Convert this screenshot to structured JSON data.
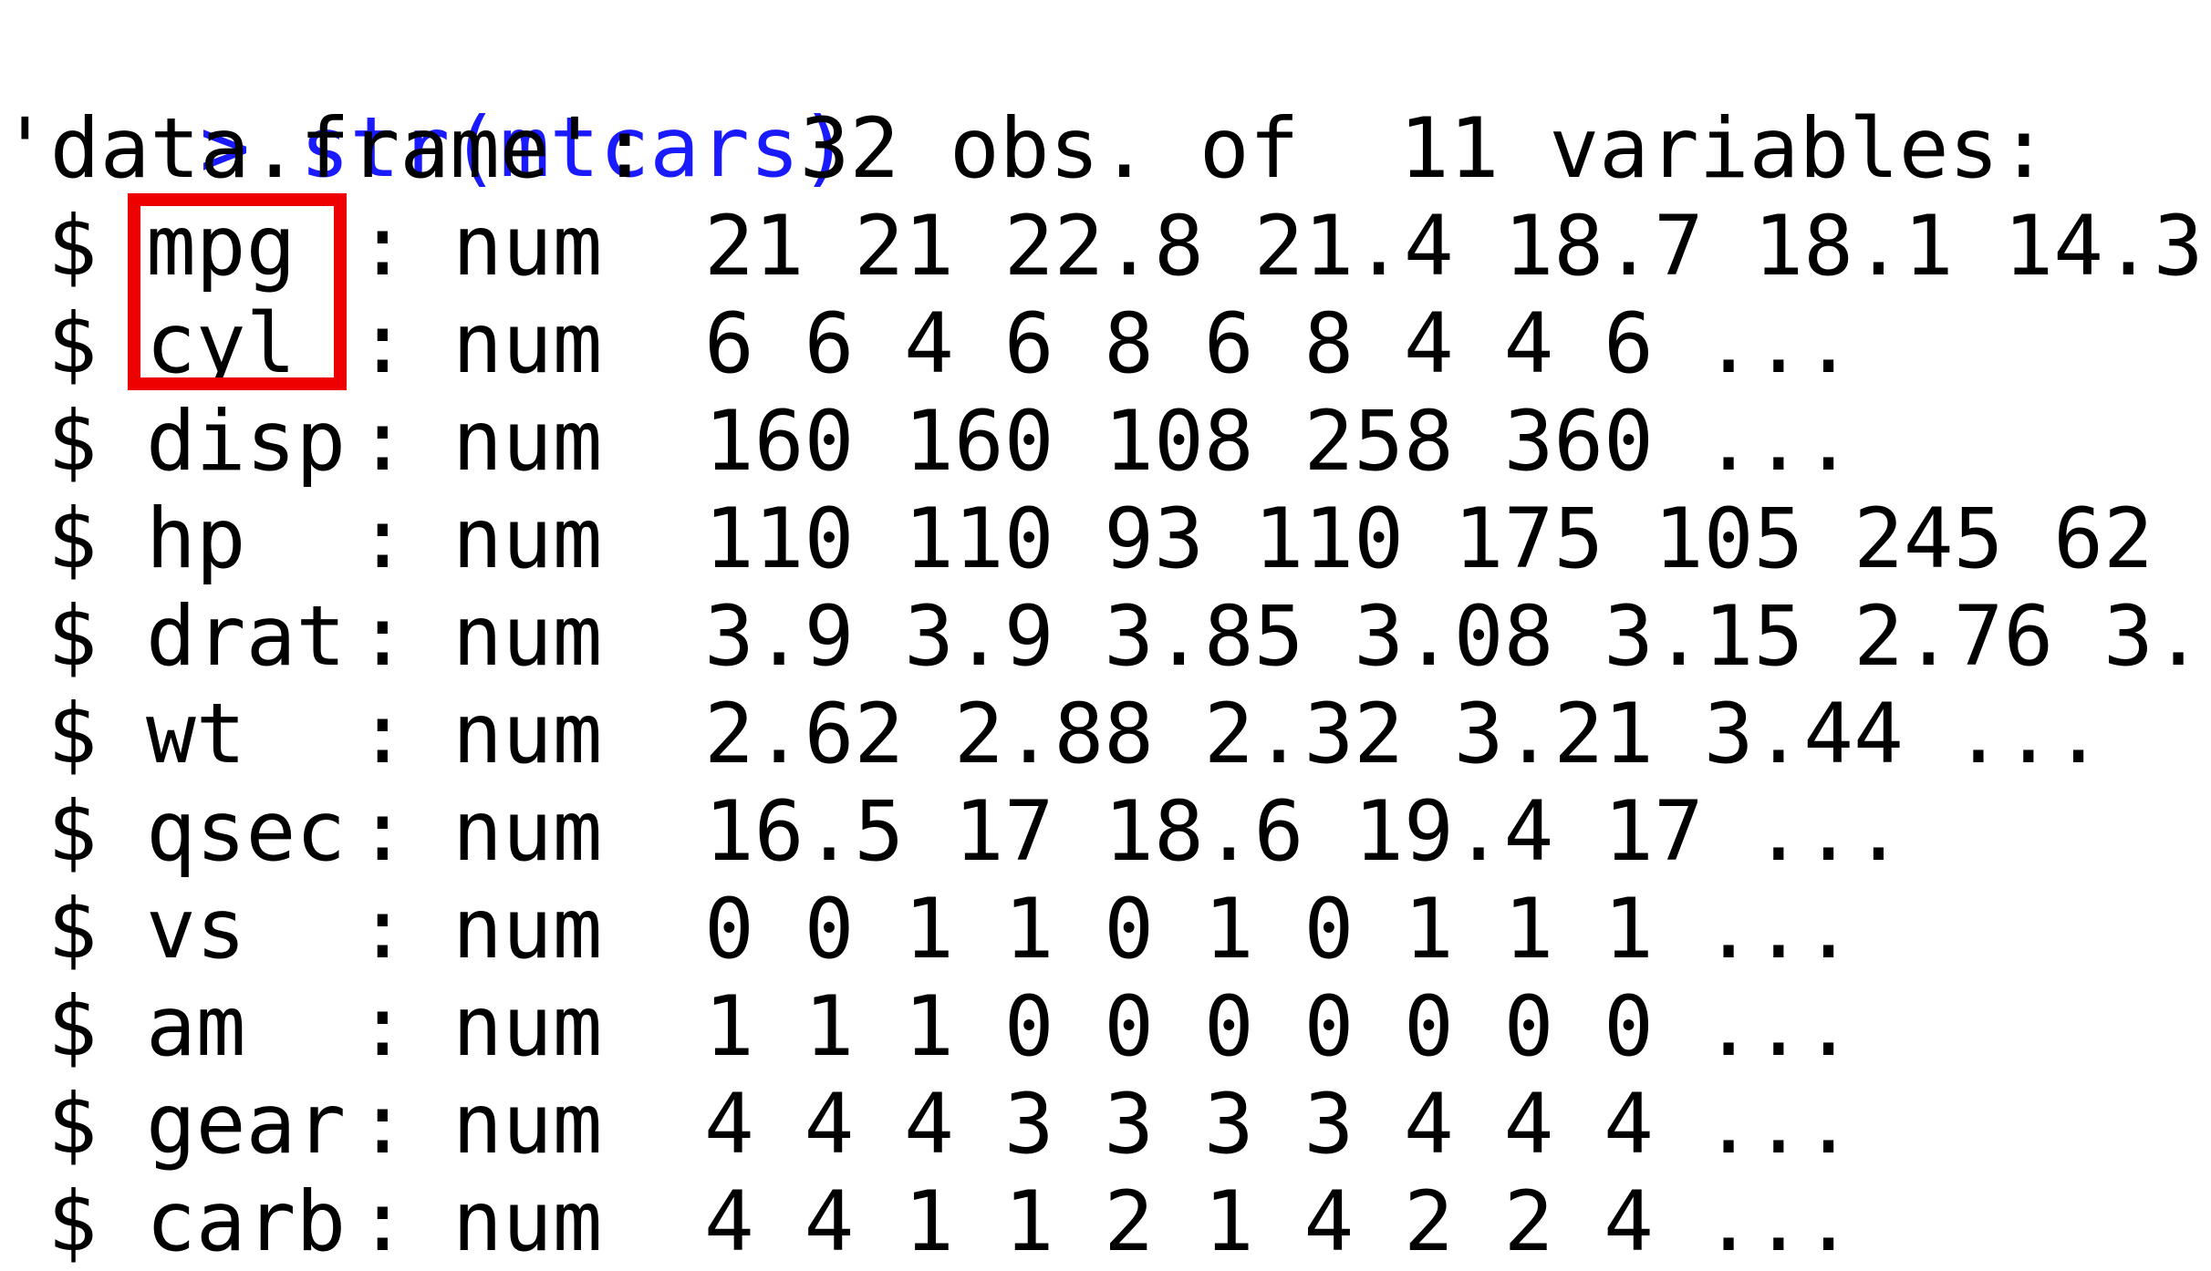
{
  "console": {
    "prompt_symbol": ">",
    "command": "str(mtcars)",
    "summary": "'data.frame':   32 obs. of  11 variables:",
    "rows": [
      {
        "dollar": "$",
        "name": "mpg",
        "colon": ":",
        "type": "num",
        "values": "21 21 22.8 21.4 18.7 18.1 14.3"
      },
      {
        "dollar": "$",
        "name": "cyl",
        "colon": ":",
        "type": "num",
        "values": "6 6 4 6 8 6 8 4 4 6 ..."
      },
      {
        "dollar": "$",
        "name": "disp",
        "colon": ":",
        "type": "num",
        "values": "160 160 108 258 360 ..."
      },
      {
        "dollar": "$",
        "name": "hp",
        "colon": ":",
        "type": "num",
        "values": "110 110 93 110 175 105 245 62"
      },
      {
        "dollar": "$",
        "name": "drat",
        "colon": ":",
        "type": "num",
        "values": "3.9 3.9 3.85 3.08 3.15 2.76 3."
      },
      {
        "dollar": "$",
        "name": "wt",
        "colon": ":",
        "type": "num",
        "values": "2.62 2.88 2.32 3.21 3.44 ..."
      },
      {
        "dollar": "$",
        "name": "qsec",
        "colon": ":",
        "type": "num",
        "values": "16.5 17 18.6 19.4 17 ..."
      },
      {
        "dollar": "$",
        "name": "vs",
        "colon": ":",
        "type": "num",
        "values": "0 0 1 1 0 1 0 1 1 1 ..."
      },
      {
        "dollar": "$",
        "name": "am",
        "colon": ":",
        "type": "num",
        "values": "1 1 1 0 0 0 0 0 0 0 ..."
      },
      {
        "dollar": "$",
        "name": "gear",
        "colon": ":",
        "type": "num",
        "values": "4 4 4 3 3 3 3 4 4 4 ..."
      },
      {
        "dollar": "$",
        "name": "carb",
        "colon": ":",
        "type": "num",
        "values": "4 4 1 1 2 1 4 2 2 4 ..."
      }
    ],
    "colors": {
      "prompt": "#1a1aff",
      "text": "#000000",
      "highlight": "#ee0000",
      "background": "#ffffff"
    }
  }
}
